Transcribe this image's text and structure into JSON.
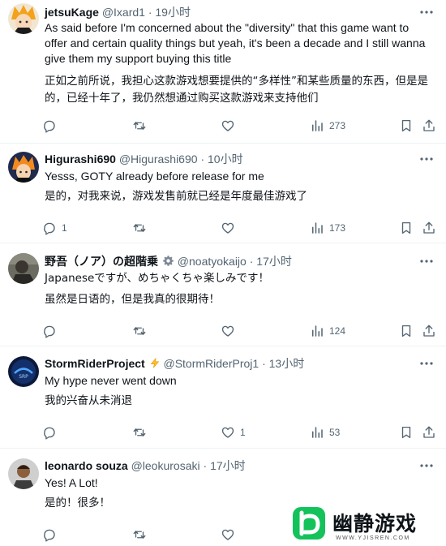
{
  "colors": {
    "text": "#0f1419",
    "secondary": "#536471",
    "divider": "#eff3f4",
    "watermark_green": "#13c25b"
  },
  "tweets": [
    {
      "display_name": "jetsuKage",
      "handle": "@Ixard1",
      "separator": "·",
      "time": "19小时",
      "text": "As said before I'm concerned about the \"diversity\" that this game want to offer and certain quality things but yeah, it's been a decade and I still wanna give them my support buying this title",
      "translation": "正如之前所说，我担心这款游戏想要提供的“多样性”和某些质量的东西，但是是的，已经十年了，我仍然想通过购买这款游戏来支持他们",
      "replies": "",
      "retweets": "",
      "likes": "",
      "views": "273",
      "avatar_icon": "anime-avatar-icon"
    },
    {
      "display_name": "Higurashi690",
      "handle": "@Higurashi690",
      "separator": "·",
      "time": "10小时",
      "text": "Yesss, GOTY already before release for me",
      "translation": "是的，对我来说，游戏发售前就已经是年度最佳游戏了",
      "replies": "1",
      "retweets": "",
      "likes": "",
      "views": "173",
      "avatar_icon": "anime-avatar-icon"
    },
    {
      "display_name": "野吾（ノア）の超階乗",
      "handle": "@noatyokaijo",
      "separator": "·",
      "time": "17小时",
      "text": "Japaneseですが、めちゃくちゃ楽しみです！",
      "translation": "虽然是日语的，但是我真的很期待！",
      "replies": "",
      "retweets": "",
      "likes": "",
      "views": "124",
      "avatar_icon": "photo-avatar-icon",
      "badge_icon": "gear-icon"
    },
    {
      "display_name": "StormRiderProject",
      "handle": "@StormRiderProj1",
      "separator": "·",
      "time": "13小时",
      "text": "My hype never went down",
      "translation": "我的兴奋从未消退",
      "replies": "",
      "retweets": "",
      "likes": "1",
      "views": "53",
      "avatar_icon": "logo-avatar-icon",
      "badge_icon": "lightning-icon"
    },
    {
      "display_name": "leonardo souza",
      "handle": "@leokurosaki",
      "separator": "·",
      "time": "17小时",
      "text": "Yes! A Lot!",
      "translation": "是的！很多！",
      "replies": "",
      "retweets": "",
      "likes": "",
      "views": "",
      "avatar_icon": "photo-avatar-icon"
    }
  ],
  "watermark": {
    "title": "幽静游戏",
    "url": "WWW.YJISREN.COM"
  }
}
